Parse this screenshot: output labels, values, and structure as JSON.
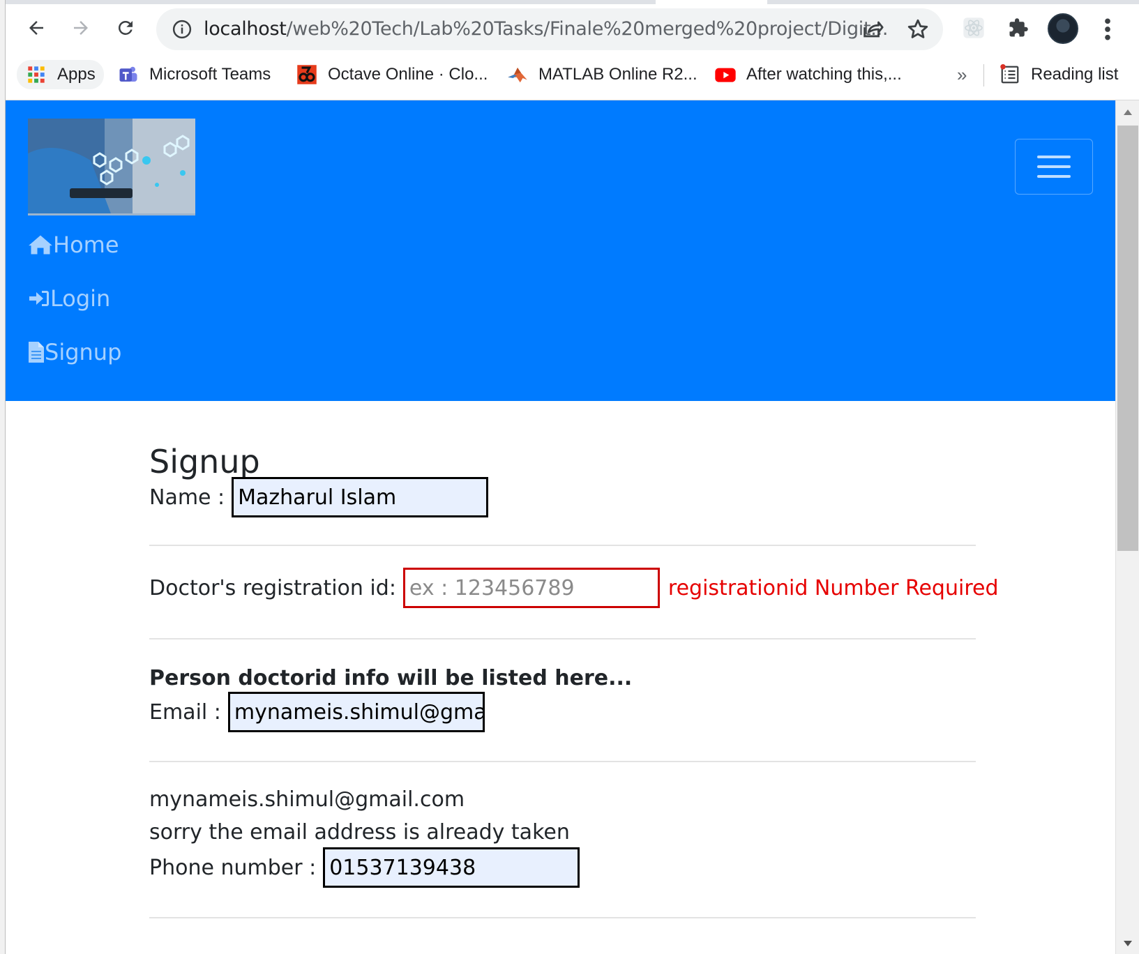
{
  "browser": {
    "url_host": "localhost",
    "url_path": "/web%20Tech/Lab%20Tasks/Finale%20merged%20project/Digit...",
    "bookmarks": [
      {
        "label": "Apps",
        "icon": "apps-grid-icon"
      },
      {
        "label": "Microsoft Teams",
        "icon": "teams-icon"
      },
      {
        "label": "Octave Online · Clo...",
        "icon": "octave-icon"
      },
      {
        "label": "MATLAB Online R2...",
        "icon": "matlab-icon"
      },
      {
        "label": "After watching this,...",
        "icon": "youtube-icon"
      }
    ],
    "overflow": "»",
    "reading_list": "Reading list"
  },
  "navbar": {
    "color": "#007bff",
    "links": [
      {
        "label": "Home",
        "icon": "home-icon"
      },
      {
        "label": "Login",
        "icon": "sign-in-icon"
      },
      {
        "label": "Signup",
        "icon": "file-text-icon"
      }
    ]
  },
  "form": {
    "title": "Signup",
    "name_label": "Name :",
    "name_value": "Mazharul Islam",
    "reg_label": "Doctor's registration id:",
    "reg_placeholder": "ex : 123456789",
    "reg_error": "registrationid Number Required",
    "info_heading": "Person doctorid info will be listed here...",
    "email_label": "Email :",
    "email_value": "mynameis.shimul@gmail.com",
    "email_echo": "mynameis.shimul@gmail.com",
    "email_taken": "sorry the email address is already taken",
    "phone_label": "Phone number :",
    "phone_value": "01537139438"
  }
}
